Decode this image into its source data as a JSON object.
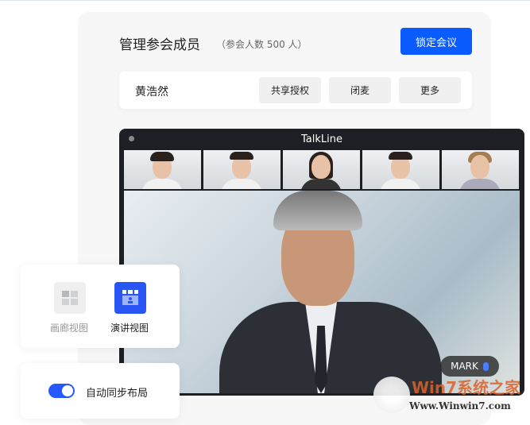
{
  "header": {
    "title": "管理参会成员",
    "count_text": "（参会人数 500 人）",
    "lock_button": "锁定会议"
  },
  "member": {
    "name": "黄浩然",
    "actions": [
      "共享授权",
      "闭麦",
      "更多"
    ]
  },
  "window": {
    "title": "TalkLine",
    "speaker_label": "MARK"
  },
  "views": {
    "gallery": "画廊视图",
    "speaker": "演讲视图",
    "selected": "speaker"
  },
  "sync": {
    "label": "自动同步布局",
    "enabled": true
  },
  "watermark": {
    "brand": "Win7系统之家",
    "url": "Www.Winwin7.com"
  },
  "colors": {
    "accent": "#0b5cff"
  }
}
